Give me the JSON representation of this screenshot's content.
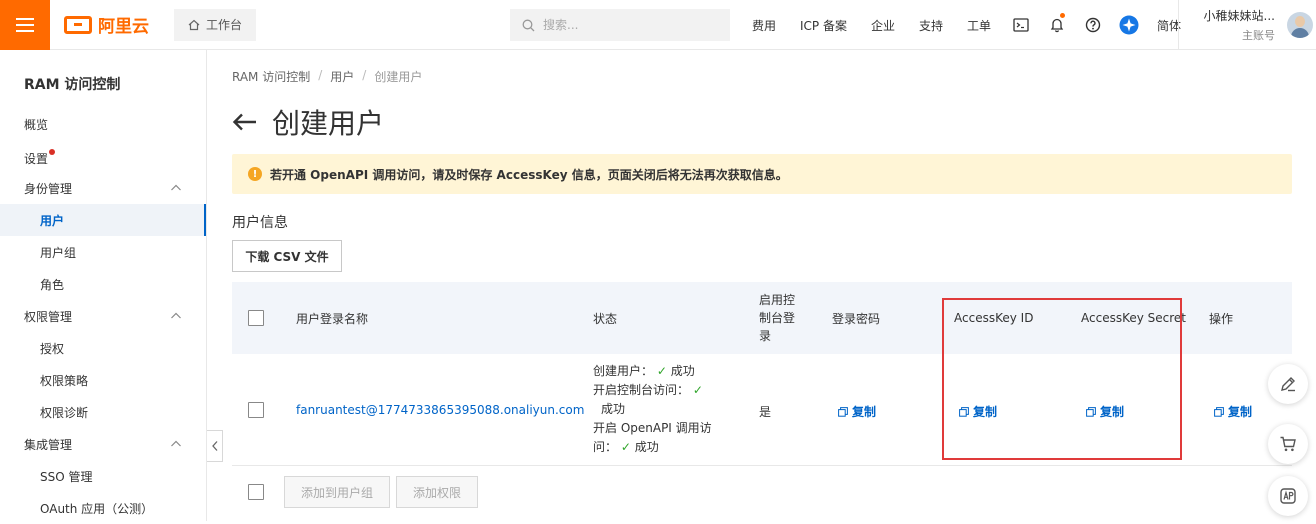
{
  "header": {
    "logo_text": "阿里云",
    "workbench_label": "工作台",
    "search_placeholder": "搜索...",
    "nav": [
      "费用",
      "ICP 备案",
      "企业",
      "支持",
      "工单"
    ],
    "language": "简体",
    "user_name": "小稚妹妹站...",
    "user_role": "主账号",
    "accent_color": "#ff6a00"
  },
  "sidebar": {
    "title": "RAM 访问控制",
    "items": [
      {
        "label": "概览"
      },
      {
        "label": "设置"
      },
      {
        "label": "身份管理"
      },
      {
        "label": "用户"
      },
      {
        "label": "用户组"
      },
      {
        "label": "角色"
      },
      {
        "label": "权限管理"
      },
      {
        "label": "授权"
      },
      {
        "label": "权限策略"
      },
      {
        "label": "权限诊断"
      },
      {
        "label": "集成管理"
      },
      {
        "label": "SSO 管理"
      },
      {
        "label": "OAuth 应用（公测）"
      }
    ]
  },
  "breadcrumb": [
    "RAM 访问控制",
    "用户",
    "创建用户"
  ],
  "page": {
    "title": "创建用户",
    "alert": "若开通 OpenAPI 调用访问，请及时保存 AccessKey 信息，页面关闭后将无法再次获取信息。",
    "section_label": "用户信息",
    "csv_button": "下载 CSV 文件"
  },
  "table": {
    "columns": [
      "用户登录名称",
      "状态",
      "启用控制台登录",
      "登录密码",
      "AccessKey ID",
      "AccessKey Secret",
      "操作"
    ],
    "row": {
      "login_name": "fanruantest@1774733865395088.onaliyun.com",
      "status": {
        "create_user": "创建用户：",
        "create_user_result": "成功",
        "console_access": "开启控制台访问：",
        "console_access_result": "成功",
        "openapi": "开启 OpenAPI 调用访",
        "openapi_tail": "问：",
        "openapi_result": "成功"
      },
      "console_login": "是",
      "copy_label": "复制"
    },
    "footer_buttons": [
      "添加到用户组",
      "添加权限"
    ]
  }
}
